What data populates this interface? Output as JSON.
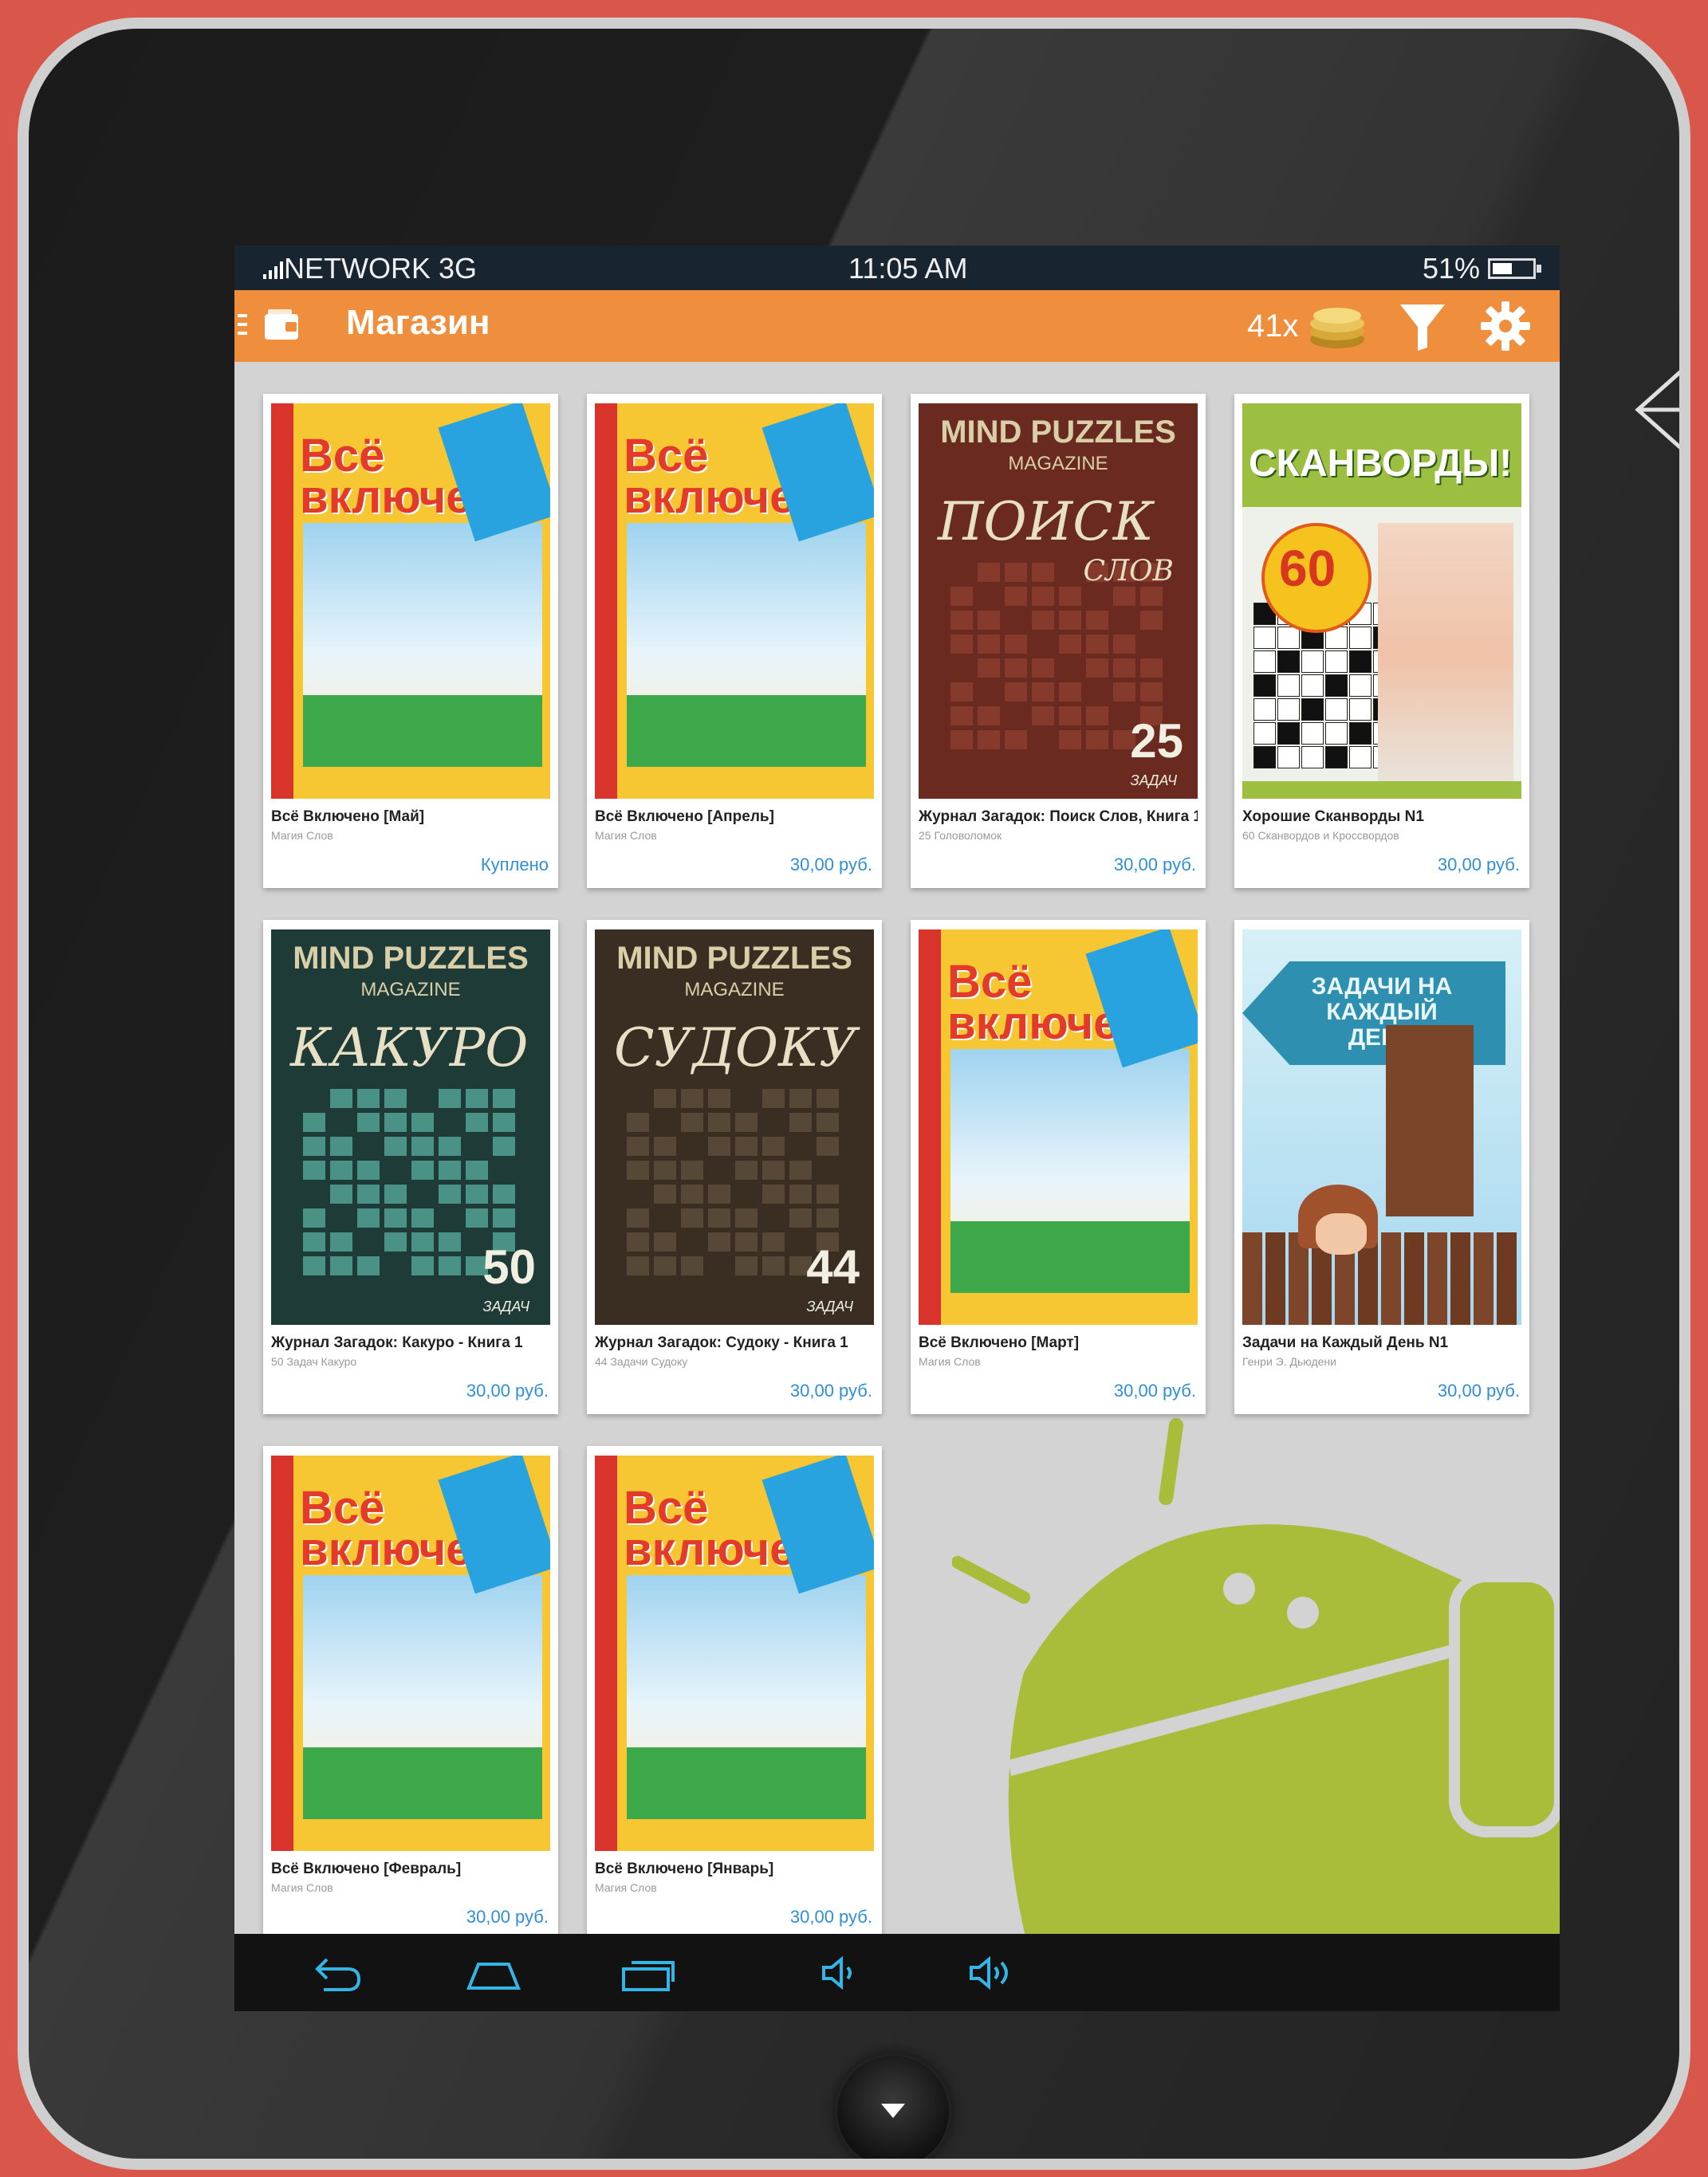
{
  "status": {
    "network": "NETWORK 3G",
    "time": "11:05 AM",
    "battery": "51%",
    "battery_level": 0.51
  },
  "app": {
    "title": "Магазин",
    "coins": "41x"
  },
  "colors": {
    "accent": "#ef8f3e",
    "price": "#2f8fd8",
    "statusbar": "#182430",
    "android": "#a9bd3b"
  },
  "items": [
    {
      "title": "Всё Включено [Май]",
      "subtitle": "Магия Слов",
      "price": "Куплено",
      "cover": "vse"
    },
    {
      "title": "Всё Включено [Апрель]",
      "subtitle": "Магия Слов",
      "price": "30,00 руб.",
      "cover": "vse"
    },
    {
      "title": "Журнал Загадок: Поиск Слов, Книга 1",
      "subtitle": "25 Головоломок",
      "price": "30,00 руб.",
      "cover": "poisk"
    },
    {
      "title": "Хорошие Сканворды N1",
      "subtitle": "60 Сканвордов и Кроссвордов",
      "price": "30,00 руб.",
      "cover": "skan"
    },
    {
      "title": "Журнал Загадок: Какуро - Книга 1",
      "subtitle": "50 Задач Какуро",
      "price": "30,00 руб.",
      "cover": "kakuro"
    },
    {
      "title": "Журнал Загадок: Судоку - Книга 1",
      "subtitle": "44 Задачи Судоку",
      "price": "30,00 руб.",
      "cover": "sudoku"
    },
    {
      "title": "Всё Включено [Март]",
      "subtitle": "Магия Слов",
      "price": "30,00 руб.",
      "cover": "vse"
    },
    {
      "title": "Задачи на Каждый День N1",
      "subtitle": "Генри Э. Дьюдени",
      "price": "30,00 руб.",
      "cover": "zadachi"
    },
    {
      "title": "Всё Включено [Февраль]",
      "subtitle": "Магия Слов",
      "price": "30,00 руб.",
      "cover": "vse"
    },
    {
      "title": "Всё Включено [Январь]",
      "subtitle": "Магия Слов",
      "price": "30,00 руб.",
      "cover": "vse"
    }
  ],
  "covers": {
    "vse_logo": "Всё включено",
    "mind_header": "MIND PUZZLES",
    "mind_sub": "MAGAZINE",
    "poisk_word": "ПОИСК",
    "poisk_sub": "СЛОВ",
    "poisk_num": "25",
    "kakuro_word": "КАКУРО",
    "kakuro_num": "50",
    "sudoku_word": "СУДОКУ",
    "sudoku_num": "44",
    "tasks": "ЗАДАЧ",
    "skan_word": "СКАНВОРДЫ!",
    "skan_num": "60",
    "zadachi_word": "ЗАДАЧИ НА КАЖДЫЙ ДЕНЬ"
  },
  "navbar": [
    "back-icon",
    "home-icon",
    "recents-icon",
    "volume-down-icon",
    "volume-up-icon"
  ]
}
